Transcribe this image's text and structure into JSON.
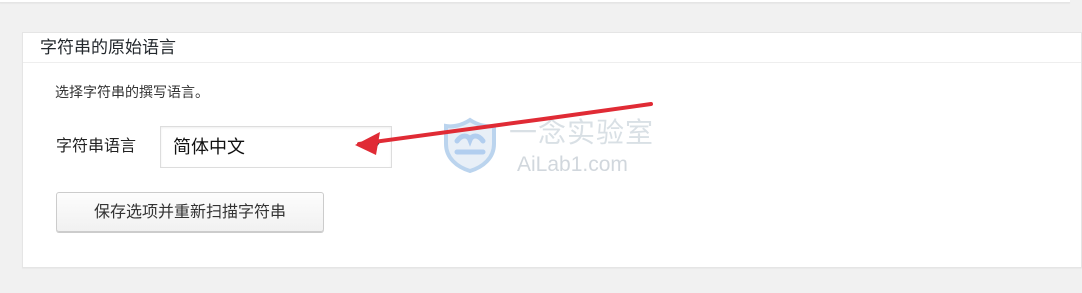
{
  "section": {
    "title": "字符串的原始语言",
    "description": "选择字符串的撰写语言。"
  },
  "language_field": {
    "label": "字符串语言",
    "selected_value": "简体中文"
  },
  "actions": {
    "save_rescan_label": "保存选项并重新扫描字符串"
  },
  "watermark": {
    "brand_cn": "一念实验室",
    "brand_en": "AiLab1.com"
  },
  "icons": {
    "select_arrow": "triangle-down-icon",
    "annotation_arrow": "red-arrow-icon",
    "watermark_logo": "shield-logo-icon"
  },
  "colors": {
    "annotation": "#e02b35",
    "watermark": "#c6d0d8"
  }
}
